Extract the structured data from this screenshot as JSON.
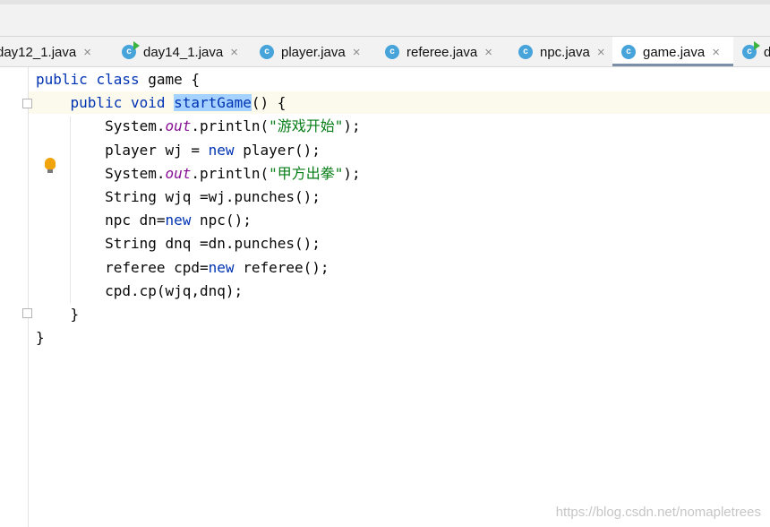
{
  "tabs": [
    {
      "label": "day12_1.java",
      "icon": "java-class-icon",
      "has_run_badge": false,
      "active": false,
      "closable": true
    },
    {
      "label": "day14_1.java",
      "icon": "java-class-run-icon",
      "has_run_badge": true,
      "active": false,
      "closable": true
    },
    {
      "label": "player.java",
      "icon": "java-class-icon",
      "has_run_badge": false,
      "active": false,
      "closable": true
    },
    {
      "label": "referee.java",
      "icon": "java-class-icon",
      "has_run_badge": false,
      "active": false,
      "closable": true
    },
    {
      "label": "npc.java",
      "icon": "java-class-icon",
      "has_run_badge": false,
      "active": false,
      "closable": true
    },
    {
      "label": "game.java",
      "icon": "java-class-icon",
      "has_run_badge": false,
      "active": true,
      "closable": true
    },
    {
      "label": "d",
      "icon": "java-class-run-icon",
      "has_run_badge": true,
      "active": false,
      "closable": false
    }
  ],
  "tab_icon_letter": "c",
  "close_glyph": "×",
  "editor": {
    "lines": [
      [
        {
          "t": "public",
          "c": "kw"
        },
        {
          "t": " "
        },
        {
          "t": "class",
          "c": "kw"
        },
        {
          "t": " game {"
        }
      ],
      [
        {
          "t": "    "
        },
        {
          "t": "public",
          "c": "kw"
        },
        {
          "t": " "
        },
        {
          "t": "void",
          "c": "kw"
        },
        {
          "t": " "
        },
        {
          "t": "startGame",
          "c": "kw sel"
        },
        {
          "t": "() {"
        }
      ],
      [
        {
          "t": "        System."
        },
        {
          "t": "out",
          "c": "field"
        },
        {
          "t": ".println("
        },
        {
          "t": "\"游戏开始\"",
          "c": "str"
        },
        {
          "t": ");"
        }
      ],
      [
        {
          "t": "        player wj = "
        },
        {
          "t": "new",
          "c": "kw"
        },
        {
          "t": " player();"
        }
      ],
      [
        {
          "t": "        System."
        },
        {
          "t": "out",
          "c": "field"
        },
        {
          "t": ".println("
        },
        {
          "t": "\"甲方出拳\"",
          "c": "str"
        },
        {
          "t": ");"
        }
      ],
      [
        {
          "t": "        String wjq =wj.punches();"
        }
      ],
      [
        {
          "t": "        npc dn="
        },
        {
          "t": "new",
          "c": "kw"
        },
        {
          "t": " npc();"
        }
      ],
      [
        {
          "t": "        String dnq =dn.punches();"
        }
      ],
      [
        {
          "t": "        referee cpd="
        },
        {
          "t": "new",
          "c": "kw"
        },
        {
          "t": " referee();"
        }
      ],
      [
        {
          "t": "        cpd.cp(wjq,dnq);"
        }
      ],
      [
        {
          "t": "    }"
        }
      ],
      [
        {
          "t": "}"
        }
      ]
    ],
    "caret_line": 2,
    "selected_word": "startGame",
    "intention_icon": "lightbulb-icon"
  },
  "colors": {
    "keyword": "#0033b3",
    "string": "#067d17",
    "static_field": "#871094",
    "selection": "#a6d2ff",
    "tab_active_underline": "#7c8fa8",
    "java_icon": "#47a4db"
  },
  "watermark": "https://blog.csdn.net/nomapletrees"
}
